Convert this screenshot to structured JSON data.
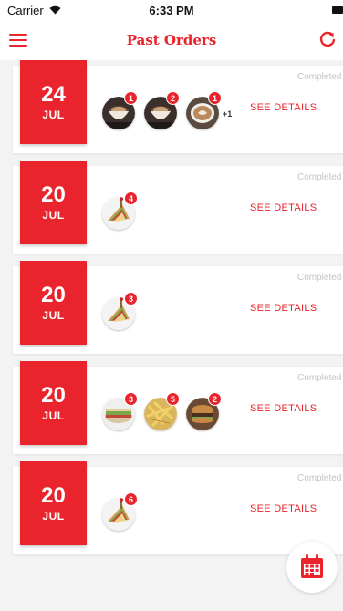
{
  "status_bar": {
    "carrier": "Carrier",
    "time": "6:33 PM"
  },
  "header": {
    "title": "Past Orders"
  },
  "orders": [
    {
      "day": "24",
      "month": "JUL",
      "status": "Completed",
      "items": [
        {
          "qty": "1",
          "image": "coffee-cup"
        },
        {
          "qty": "2",
          "image": "coffee-cup"
        },
        {
          "qty": "1",
          "image": "latte-cup"
        }
      ],
      "more": "+1",
      "action": "SEE DETAILS"
    },
    {
      "day": "20",
      "month": "JUL",
      "status": "Completed",
      "items": [
        {
          "qty": "4",
          "image": "club-sandwich"
        }
      ],
      "action": "SEE DETAILS"
    },
    {
      "day": "20",
      "month": "JUL",
      "status": "Completed",
      "items": [
        {
          "qty": "3",
          "image": "club-sandwich"
        }
      ],
      "action": "SEE DETAILS"
    },
    {
      "day": "20",
      "month": "JUL",
      "status": "Completed",
      "items": [
        {
          "qty": "3",
          "image": "sandwich-plate"
        },
        {
          "qty": "5",
          "image": "fries"
        },
        {
          "qty": "2",
          "image": "burger"
        }
      ],
      "action": "SEE DETAILS"
    },
    {
      "day": "20",
      "month": "JUL",
      "status": "Completed",
      "items": [
        {
          "qty": "6",
          "image": "club-sandwich"
        }
      ],
      "action": "SEE DETAILS"
    }
  ],
  "colors": {
    "accent": "#e9242c",
    "background": "#f3f3f3",
    "muted": "#c4c4c4"
  },
  "icons": {
    "menu": "hamburger-menu-icon",
    "refresh": "refresh-icon",
    "calendar": "calendar-icon"
  }
}
